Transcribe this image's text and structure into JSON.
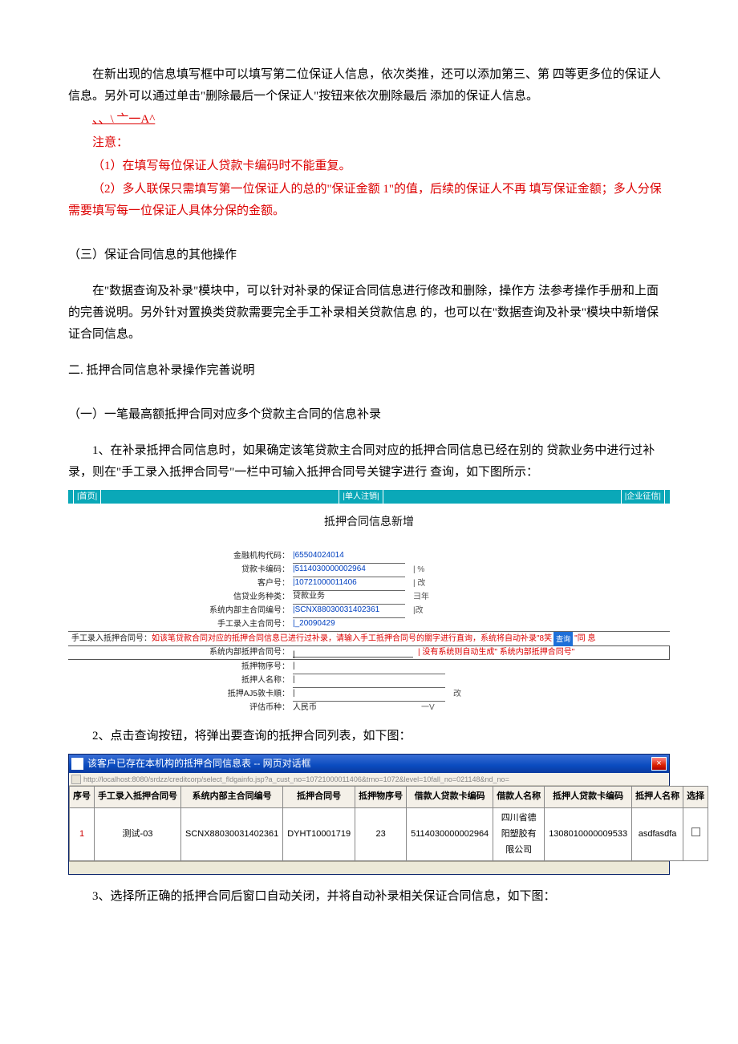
{
  "intro": {
    "p1": "在新出现的信息填写框中可以填写第二位保证人信息，依次类推，还可以添加第三、第 四等更多位的保证人信息。另外可以通过单击\"删除最后一个保证人\"按钮来依次删除最后 添加的保证人信息。",
    "symbol_line": "、、\\ 亠一A^",
    "note_head": "注意：",
    "note1": "（1）在填写每位保证人贷款卡编码时不能重复。",
    "note2": "（2）多人联保只需填写第一位保证人的总的\"保证金额 1\"的值，后续的保证人不再 填写保证金额；多人分保需要填写每一位保证人具体分保的金额。"
  },
  "section3_title": "（三）保证合同信息的其他操作",
  "section3_body": "在\"数据查询及补录\"模块中，可以针对补录的保证合同信息进行修改和删除，操作方 法参考操作手册和上面的完善说明。另外针对置换类贷款需要完全手工补录相关贷款信息 的，也可以在\"数据查询及补录\"模块中新增保证合同信息。",
  "heading2": "二. 抵押合同信息补录操作完善说明",
  "sub1_title": "（一）一笔最高额抵押合同对应多个贷款主合同的信息补录",
  "step1": "1、在补录抵押合同信息时，如果确定该笔贷款主合同对应的抵押合同信息已经在别的 贷款业务中进行过补录，则在\"手工录入抵押合同号\"一栏中可输入抵押合同号关键字进行 查询，如下图所示：",
  "form": {
    "tab_left": "|首页|",
    "tab_mid": "|单人注销|",
    "tab_right": "|企业征信|",
    "title": "抵押合同信息新增",
    "row_org_lbl": "金融机构代码：",
    "row_org_val": "|65504024014",
    "row_card_lbl": "贷款卡编码：",
    "row_card_val": "|5114030000002964",
    "row_card_suffix": "| %",
    "row_cust_lbl": "客户号：",
    "row_cust_val": "|10721000011406",
    "row_cust_suffix": "| 改",
    "row_type_lbl": "信贷业务种类：",
    "row_type_val": "贷款业务",
    "row_type_suffix": "彐年",
    "row_sys_lbl": "系统内部主合同编号：",
    "row_sys_val": "|SCNX88030031402361",
    "row_sys_suffix": "|改",
    "row_main_lbl": "手工录入主合同号：",
    "row_main_val": "|_20090429",
    "manual_lbl": "手工录入抵押合同号：",
    "manual_hint": "如该笔贷款合同对应的抵押合同信息已进行过补录，请输入手工抵押合同号的關字进行直询，系统将自动补录\"8笑",
    "manual_btn": "査询",
    "manual_trail": "\"同 息",
    "row_syspledge_lbl": "系统内部抵押合同号：",
    "row_syspledge_val": "|",
    "row_syspledge_note": "| 没有系统则自动生成\" 系统内部抵押合同号\"",
    "row_pno_lbl": "抵押物序号：",
    "row_pno_val": "|",
    "row_pname_lbl": "抵押人名称：",
    "row_pname_val": "|",
    "row_pcard_lbl": "抵押AJ5敦卡順：",
    "row_pcard_val": "|",
    "row_pcard_suffix": "改",
    "row_curr_lbl": "评估币种：",
    "row_curr_val": "人民币",
    "row_curr_suffix": "一V"
  },
  "step2": "2、点击查询按钮，将弹出要查询的抵押合同列表，如下图：",
  "dialog": {
    "title": "该客户已存在本机构的抵押合同信息表 -- 网页对话框",
    "url": "http://localhost:8080/srdzz/creditcorp/select_fldgainfo.jsp?a_cust_no=10721000011406&trno=1072&level=10fall_no=021148&nd_no=",
    "headers": [
      "序号",
      "手工录入抵押合同号",
      "系统内部主合同编号",
      "抵押合同号",
      "抵押物序号",
      "借款人贷款卡编码",
      "借款人名称",
      "抵押人贷款卡编码",
      "抵押人名称",
      "选择"
    ],
    "row": {
      "idx": "1",
      "manual_no": "测试-03",
      "sys_main": "SCNX88030031402361",
      "pledge_no": "DYHT10001719",
      "pno": "23",
      "borrow_card": "5114030000002964",
      "borrow_name": "四川省德阳塑胶有限公司",
      "pledger_card": "1308010000009533",
      "pledger_name": "asdfasdfa"
    }
  },
  "step3": "3、选择所正确的抵押合同后窗口自动关闭，并将自动补录相关保证合同信息，如下图："
}
